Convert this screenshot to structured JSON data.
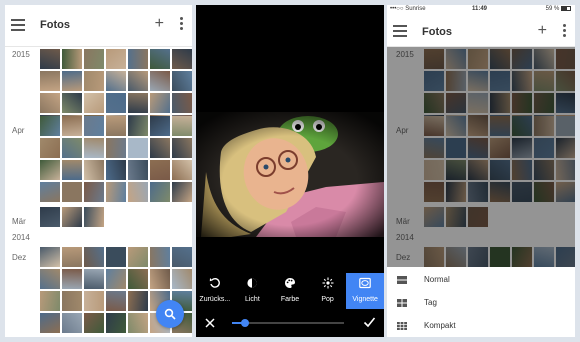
{
  "left_screen": {
    "app_title": "Fotos",
    "sections": [
      "2015",
      "Apr",
      "Mär",
      "2014",
      "Dez"
    ],
    "menu_icon": "hamburger-icon",
    "add_icon": "plus-icon",
    "more_icon": "more-vert-icon",
    "fab_icon": "search-icon",
    "accent_color": "#4285f4"
  },
  "editor_screen": {
    "filters": [
      {
        "label": "Zurücks...",
        "icon": "undo-icon"
      },
      {
        "label": "Licht",
        "icon": "brightness-icon"
      },
      {
        "label": "Farbe",
        "icon": "palette-icon"
      },
      {
        "label": "Pop",
        "icon": "sparkle-icon"
      },
      {
        "label": "Vignette",
        "icon": "vignette-icon",
        "active": true
      }
    ],
    "slider_value_percent": 12,
    "close_icon": "close-icon",
    "confirm_icon": "check-icon"
  },
  "right_screen": {
    "status": {
      "carrier": "•••○○ Sunrise",
      "time": "11:49",
      "battery": "59 %"
    },
    "app_title": "Fotos",
    "sections": [
      "2015",
      "Apr",
      "Mär",
      "2014",
      "Dez"
    ],
    "view_menu": [
      {
        "label": "Normal",
        "icon": "grid-normal-icon"
      },
      {
        "label": "Tag",
        "icon": "grid-day-icon"
      },
      {
        "label": "Kompakt",
        "icon": "grid-compact-icon"
      }
    ]
  }
}
